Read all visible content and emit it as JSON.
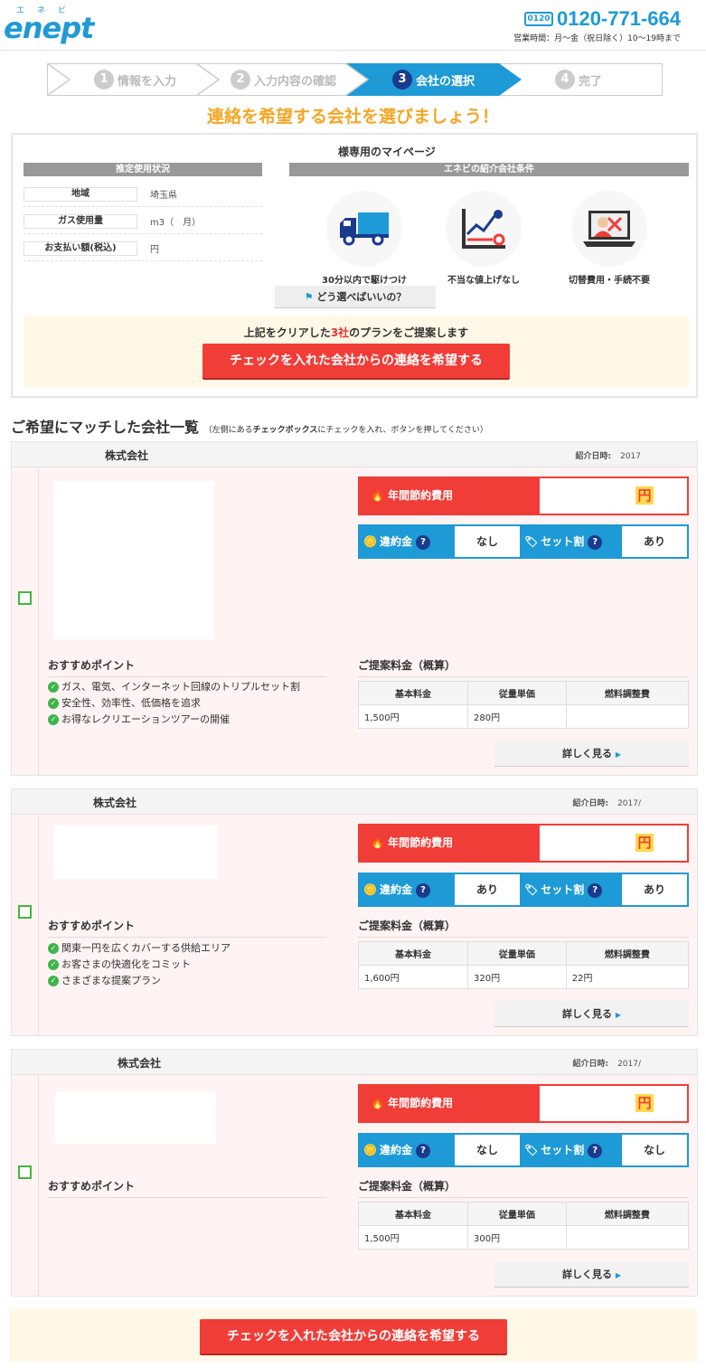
{
  "header": {
    "logo_kana": "エネビ",
    "logo_text": "enept",
    "free_dial_label": "0120",
    "phone": "0120-771-664",
    "hours": "営業時間：月〜金（祝日除く）10〜19時まで"
  },
  "steps": [
    {
      "num": "1",
      "label": "情報を入力"
    },
    {
      "num": "2",
      "label": "入力内容の確認"
    },
    {
      "num": "3",
      "label": "会社の選択"
    },
    {
      "num": "4",
      "label": "完了"
    }
  ],
  "headline": "連絡を希望する会社を選びましょう！",
  "panel": {
    "mypage_title": "様専用のマイページ",
    "usage_header": "推定使用状況",
    "conditions_header": "エネビの紹介会社条件",
    "usage": [
      {
        "label": "地域",
        "value": "埼玉県"
      },
      {
        "label": "ガス使用量",
        "value": "m3（　月）"
      },
      {
        "label": "お支払い額(税込)",
        "value": "円"
      }
    ],
    "features": [
      {
        "icon": "truck-icon",
        "label": "30分以内で駆けつけ"
      },
      {
        "icon": "chart-icon",
        "label": "不当な値上げなし"
      },
      {
        "icon": "laptop-icon",
        "label": "切替費用・手続不要"
      }
    ],
    "how_button": "どう選べばいいの？",
    "note_prefix": "上記をクリアした",
    "note_count": "3社",
    "note_suffix": "のプランをご提案します",
    "cta": "チェックを入れた会社からの連絡を希望する"
  },
  "list": {
    "title": "ご希望にマッチした会社一覧",
    "hint_prefix": "（左側にある",
    "hint_bold": "チェックボックス",
    "hint_suffix": "にチェックを入れ、ボタンを押してください）"
  },
  "labels": {
    "intro_date": "紹介日時:",
    "saving": "年間節約費用",
    "yen": "円",
    "penalty": "違約金",
    "set_discount": "セット割",
    "help": "?",
    "points_title": "おすすめポイント",
    "price_title": "ご提案料金（概算）",
    "col_base": "基本料金",
    "col_unit": "従量単価",
    "col_fuel": "燃料調整費",
    "more": "詳しく見る"
  },
  "companies": [
    {
      "name": "株式会社",
      "date": "2017",
      "penalty": "なし",
      "set_discount": "あり",
      "points": [
        "ガス、電気、インターネット回線のトリプルセット割",
        "安全性、効率性、低価格を追求",
        "お得なレクリエーションツアーの開催"
      ],
      "base": "1,500円",
      "unit": "280円",
      "fuel": ""
    },
    {
      "name": "株式会社",
      "date": "2017/",
      "penalty": "あり",
      "set_discount": "あり",
      "points": [
        "関東一円を広くカバーする供給エリア",
        "お客さまの快適化をコミット",
        "さまざまな提案プラン"
      ],
      "base": "1,600円",
      "unit": "320円",
      "fuel": "22円"
    },
    {
      "name": "株式会社",
      "date": "2017/",
      "penalty": "なし",
      "set_discount": "なし",
      "points": [],
      "base": "1,500円",
      "unit": "300円",
      "fuel": ""
    }
  ],
  "bottom_cta": "チェックを入れた会社からの連絡を希望する",
  "colors": {
    "brand_blue": "#1e9ad6",
    "navy": "#1a3a8e",
    "cta_red": "#f13d37",
    "heading_orange": "#f5a623",
    "check_green": "#42b83b"
  }
}
